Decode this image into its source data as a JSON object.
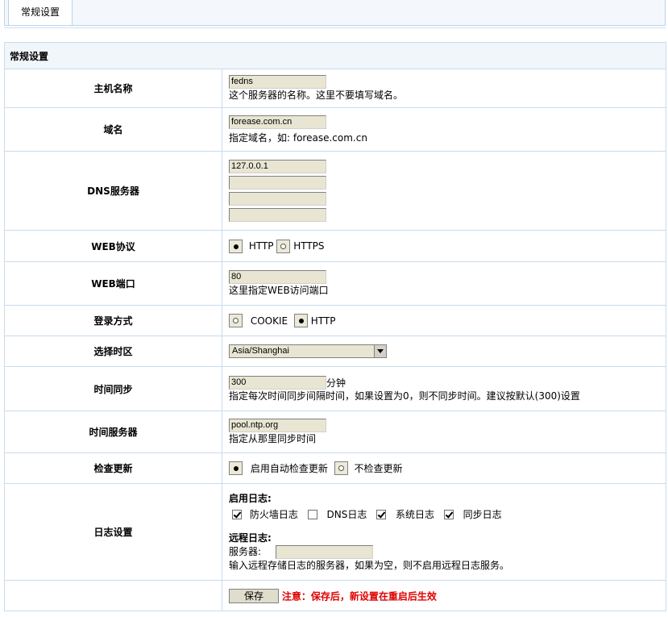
{
  "tab": {
    "label": "常规设置"
  },
  "section": {
    "title": "常规设置"
  },
  "hostname": {
    "label": "主机名称",
    "value": "fedns",
    "desc": "这个服务器的名称。这里不要填写域名。"
  },
  "domain": {
    "label": "域名",
    "value": "forease.com.cn",
    "desc": "指定域名，如: forease.com.cn"
  },
  "dns": {
    "label": "DNS服务器",
    "values": [
      "127.0.0.1",
      "",
      "",
      ""
    ]
  },
  "web_protocol": {
    "label": "WEB协议",
    "options": [
      "HTTP",
      "HTTPS"
    ],
    "selected": "HTTP"
  },
  "web_port": {
    "label": "WEB端口",
    "value": "80",
    "desc": "这里指定WEB访问端口"
  },
  "login_method": {
    "label": "登录方式",
    "options": [
      "COOKIE",
      "HTTP"
    ],
    "selected": "HTTP"
  },
  "timezone": {
    "label": "选择时区",
    "value": "Asia/Shanghai"
  },
  "time_sync": {
    "label": "时间同步",
    "value": "300",
    "unit": "分钟",
    "desc": "指定每次时间同步间隔时间，如果设置为0，则不同步时间。建议按默认(300)设置"
  },
  "time_server": {
    "label": "时间服务器",
    "value": "pool.ntp.org",
    "desc": "指定从那里同步时间"
  },
  "check_update": {
    "label": "检查更新",
    "options": [
      "启用自动检查更新",
      "不检查更新"
    ],
    "selected": "启用自动检查更新"
  },
  "log": {
    "label": "日志设置",
    "enable_title": "启用日志:",
    "items": [
      {
        "label": "防火墙日志",
        "checked": true
      },
      {
        "label": "DNS日志",
        "checked": false
      },
      {
        "label": "系统日志",
        "checked": true
      },
      {
        "label": "同步日志",
        "checked": true
      }
    ],
    "remote_title": "远程日志:",
    "server_label": "服务器:",
    "server_value": "",
    "remote_desc": "输入远程存储日志的服务器，如果为空，则不启用远程日志服务。"
  },
  "save": {
    "label": "保存",
    "note": "注意：保存后，新设置在重启后生效"
  }
}
